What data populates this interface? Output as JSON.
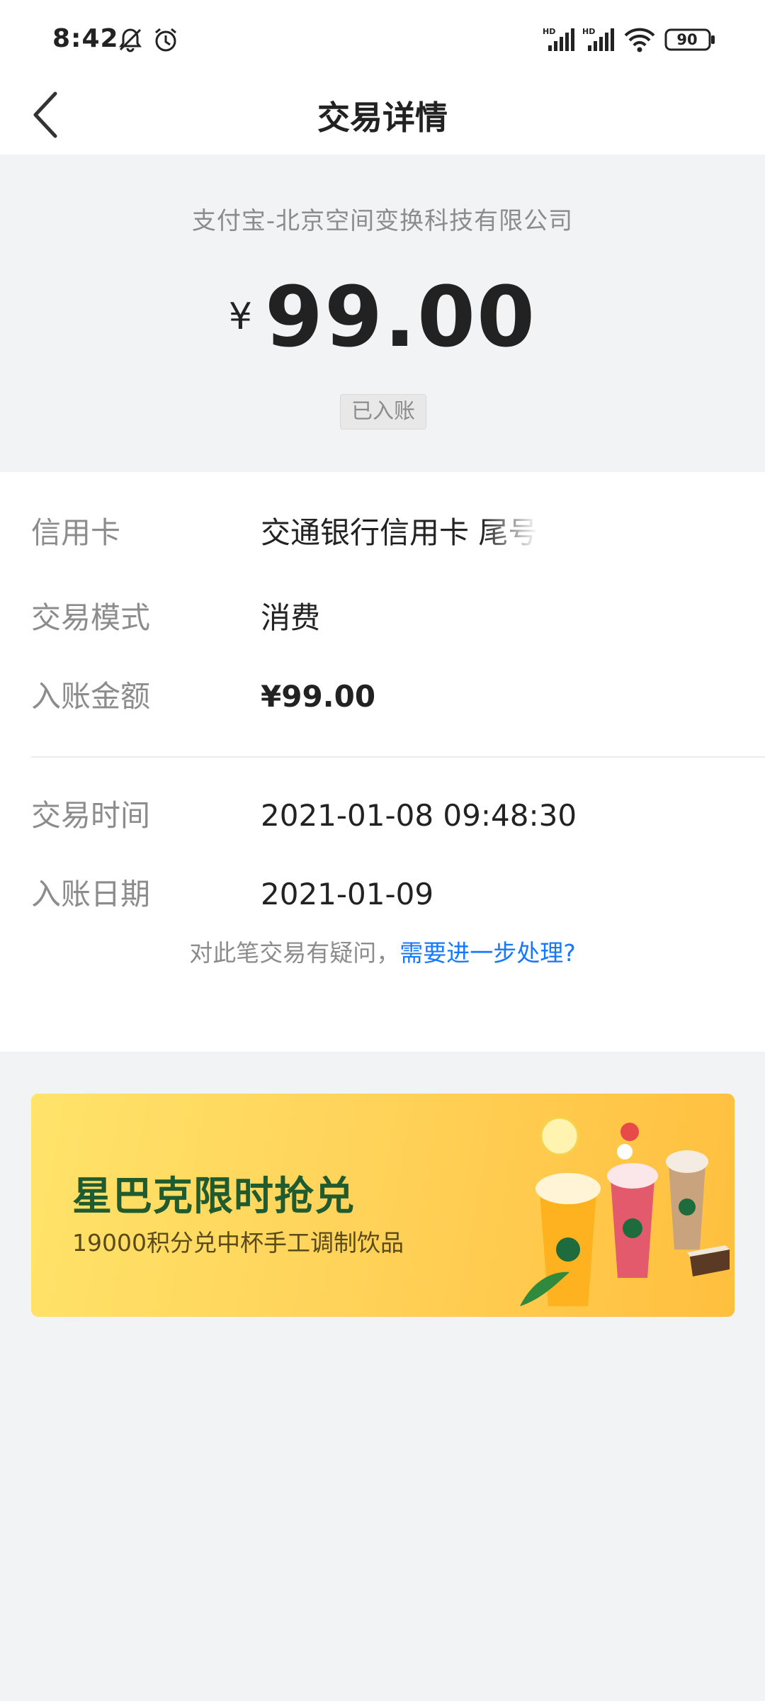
{
  "status_bar": {
    "time": "8:42",
    "icons": [
      "bell-off-icon",
      "alarm-icon",
      "signal-hd-icon",
      "signal-hd-icon",
      "wifi-icon",
      "battery-icon"
    ],
    "battery": "90"
  },
  "header": {
    "title": "交易详情",
    "back_icon": "chevron-left-icon"
  },
  "summary": {
    "merchant": "支付宝-北京空间变换科技有限公司",
    "currency": "¥",
    "amount": "99.00",
    "status": "已入账"
  },
  "details": {
    "rows_top": [
      {
        "label": "信用卡",
        "value": "交通银行信用卡 尾号"
      },
      {
        "label": "交易模式",
        "value": "消费"
      },
      {
        "label": "入账金额",
        "value": "¥99.00"
      }
    ],
    "rows_bottom": [
      {
        "label": "交易时间",
        "value": "2021-01-08 09:48:30"
      },
      {
        "label": "入账日期",
        "value": "2021-01-09"
      }
    ],
    "dispute_text": "对此笔交易有疑问，",
    "dispute_link": "需要进一步处理?"
  },
  "banner": {
    "title": "星巴克限时抢兑",
    "subtitle": "19000积分兑中杯手工调制饮品"
  },
  "colors": {
    "accent_link": "#1677ff",
    "banner_title": "#1f5b2e",
    "page_bg": "#f2f3f5"
  }
}
